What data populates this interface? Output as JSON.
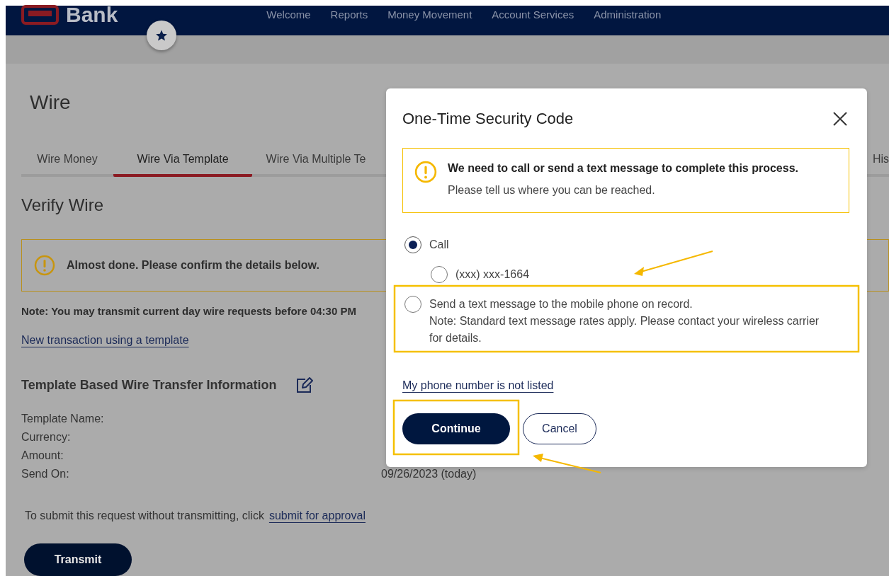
{
  "header": {
    "logo_text": "Bank",
    "nav": [
      "Welcome",
      "Reports",
      "Money Movement",
      "Account Services",
      "Administration"
    ]
  },
  "page": {
    "title": "Wire",
    "tabs": [
      {
        "label": "Wire Money",
        "selected": false
      },
      {
        "label": "Wire Via Template",
        "selected": true
      },
      {
        "label": "Wire Via Multiple Te",
        "selected": false
      },
      {
        "label": "His",
        "selected": false
      }
    ],
    "section_title": "Verify Wire",
    "alert": "Almost done. Please confirm the details below.",
    "note": "Note: You may transmit current day wire requests before 04:30 PM",
    "template_link": "New transaction using a template",
    "details_title": "Template Based Wire Transfer Information",
    "details": [
      {
        "label": "Template Name:"
      },
      {
        "label": "Currency:"
      },
      {
        "label": "Amount:"
      },
      {
        "label": "Send On:",
        "value": "09/26/2023 (today)"
      }
    ],
    "submit_text": "To submit this request without transmitting, click",
    "submit_link": "submit for approval",
    "transmit": "Transmit"
  },
  "dialog": {
    "title": "One-Time Security Code",
    "alert_title": "We need to call or send a text message to complete this process.",
    "alert_text": "Please tell us where you can be reached.",
    "options": [
      {
        "label": "Call",
        "selected": true,
        "children": [
          {
            "label": "(xxx) xxx-1664",
            "selected": false
          }
        ]
      },
      {
        "label": "Send a text message to the mobile phone on record.",
        "note": "Note: Standard text message rates apply. Please contact your wireless carrier for details.",
        "selected": false
      }
    ],
    "link": "My phone number is not listed",
    "buttons": [
      {
        "label": "Continue",
        "kind": "primary"
      },
      {
        "label": "Cancel",
        "kind": "secondary"
      }
    ]
  }
}
